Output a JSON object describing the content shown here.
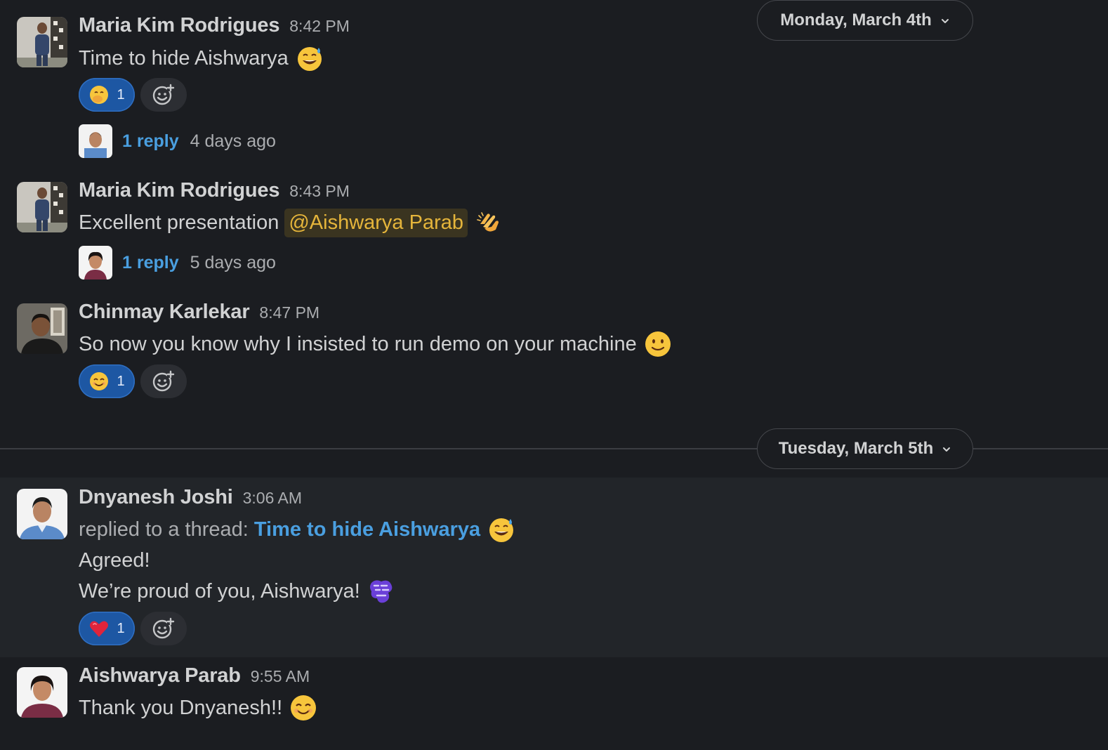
{
  "date_dividers": [
    {
      "label": "Monday, March 4th"
    },
    {
      "label": "Tuesday, March 5th"
    }
  ],
  "messages": [
    {
      "author": "Maria Kim Rodrigues",
      "time": "8:42 PM",
      "text": "Time to hide Aishwarya",
      "emoji": "sweat-smile",
      "reactions": [
        {
          "emoji": "face-with-hand-over-mouth",
          "count": "1"
        }
      ],
      "reply": {
        "count_label": "1 reply",
        "ago": "4 days ago"
      }
    },
    {
      "author": "Maria Kim Rodrigues",
      "time": "8:43 PM",
      "text": "Excellent presentation",
      "mention": "@Aishwarya Parab",
      "emoji": "clapping-hands",
      "reply": {
        "count_label": "1 reply",
        "ago": "5 days ago"
      }
    },
    {
      "author": "Chinmay Karlekar",
      "time": "8:47 PM",
      "text": "So now you know why I insisted to run demo on your machine",
      "emoji": "slightly-smiling-face",
      "reactions": [
        {
          "emoji": "smiling-face-with-smiling-eyes",
          "count": "1"
        }
      ]
    },
    {
      "author": "Dnyanesh Joshi",
      "time": "3:06 AM",
      "thread_prefix": "replied to a thread:",
      "thread_link": "Time to hide Aishwarya",
      "lines": [
        "Agreed!",
        "We’re proud of you, Aishwarya!"
      ],
      "sticker": "proud-of-you",
      "reactions": [
        {
          "emoji": "red-heart",
          "count": "1"
        }
      ]
    },
    {
      "author": "Aishwarya Parab",
      "time": "9:55 AM",
      "text": "Thank you Dnyanesh!!",
      "emoji": "smiling-face-with-smiling-eyes"
    }
  ],
  "colors": {
    "background": "#1b1d21",
    "highlight_background": "#222529",
    "link": "#4a9fe0",
    "mention_text": "#e5b53b",
    "reaction_fill": "#1d57a3"
  }
}
